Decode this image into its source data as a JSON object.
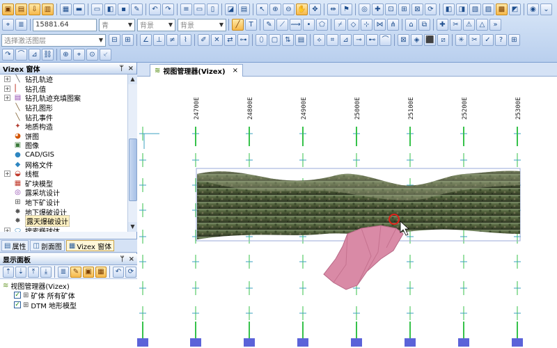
{
  "toolbar": {
    "coordinate_value": "15881.64",
    "layer_select_value": "选择激活图层",
    "combo_1": "青",
    "combo_2": "背景",
    "combo_3": "背景"
  },
  "left_panel": {
    "title": "Vizex 窗体",
    "pin": "ᛘ",
    "close": "×",
    "tree_items": [
      {
        "label": "钻孔轨迹",
        "expander": "+",
        "icon": "drillhole-trace-icon",
        "glyph": "╲",
        "color": "#666666"
      },
      {
        "label": "钻孔值",
        "expander": "+",
        "icon": "drillhole-value-icon",
        "glyph": "▏",
        "color": "#c0392b"
      },
      {
        "label": "钻孔轨迹充填图案",
        "expander": "+",
        "icon": "drillhole-fill-icon",
        "glyph": "▤",
        "color": "#8e44ad"
      },
      {
        "label": "钻孔图形",
        "expander": "",
        "icon": "drillhole-graph-icon",
        "glyph": "╲",
        "color": "#7f5f2f"
      },
      {
        "label": "钻孔事件",
        "expander": "",
        "icon": "drillhole-event-icon",
        "glyph": "╲",
        "color": "#7f5f2f"
      },
      {
        "label": "地质构造",
        "expander": "",
        "icon": "geology-structure-icon",
        "glyph": "✦",
        "color": "#b03a2e"
      },
      {
        "label": "饼图",
        "expander": "",
        "icon": "pie-chart-icon",
        "glyph": "◕",
        "color": "#d35400"
      },
      {
        "label": "图像",
        "expander": "",
        "icon": "image-icon",
        "glyph": "▣",
        "color": "#3b7a3b"
      },
      {
        "label": "CAD/GIS",
        "expander": "",
        "icon": "cad-gis-icon",
        "glyph": "●",
        "color": "#2e86c1"
      },
      {
        "label": "网格文件",
        "expander": "",
        "icon": "grid-file-icon",
        "glyph": "◆",
        "color": "#2e86c1"
      },
      {
        "label": "线框",
        "expander": "+",
        "icon": "wireframe-icon",
        "glyph": "◒",
        "color": "#c0392b"
      },
      {
        "label": "矿块模型",
        "expander": "",
        "icon": "block-model-icon",
        "glyph": "▦",
        "color": "#c0392b"
      },
      {
        "label": "露采坑设计",
        "expander": "",
        "icon": "pit-design-icon",
        "glyph": "◎",
        "color": "#8e44ad"
      },
      {
        "label": "地下矿设计",
        "expander": "",
        "icon": "underground-design-icon",
        "glyph": "⊞",
        "color": "#555555"
      },
      {
        "label": "地下爆破设计",
        "expander": "",
        "icon": "underground-blast-icon",
        "glyph": "✸",
        "color": "#555555"
      },
      {
        "label": "露天爆破设计",
        "expander": "",
        "icon": "open-pit-blast-icon",
        "glyph": "✸",
        "color": "#555555",
        "selected": true
      },
      {
        "label": "搜索椭球体",
        "expander": "+",
        "icon": "search-ellipsoid-icon",
        "glyph": "⬭",
        "color": "#2e86c1"
      }
    ],
    "tabs": [
      {
        "label": "属性",
        "icon": "properties-icon",
        "glyph": "▤"
      },
      {
        "label": "剖面图",
        "icon": "section-icon",
        "glyph": "◫"
      },
      {
        "label": "Vizex 窗体",
        "icon": "vizex-form-icon",
        "glyph": "▦",
        "active": true
      }
    ]
  },
  "display_panel": {
    "title": "显示面板",
    "pin": "ᛘ",
    "close": "×",
    "root_label": "视图管理器(Vizex)",
    "layers": [
      {
        "label": "矿体 所有矿体",
        "checked": true
      },
      {
        "label": "DTM 地形模型",
        "checked": true
      }
    ]
  },
  "document": {
    "tab_label": "视图管理器(Vizex)",
    "close": "×"
  },
  "viewport": {
    "grid_labels": [
      "24700E",
      "24800E",
      "24900E",
      "25000E",
      "25100E",
      "25200E",
      "25300E"
    ],
    "colors": {
      "grid_line": "#36c24a",
      "grid_cross": "#3ba0c0",
      "orebody": "#d98aa6",
      "bbox": "#9aa8d8",
      "bottom_marker": "#5b63d9"
    }
  }
}
